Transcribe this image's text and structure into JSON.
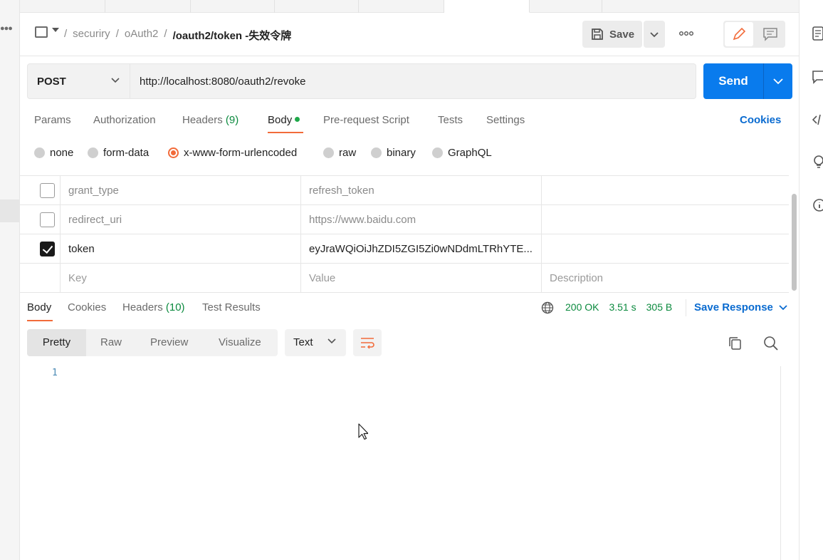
{
  "breadcrumb": {
    "items": [
      "securiry",
      "/",
      "oAuth2",
      "/"
    ],
    "current": "/oauth2/token -失效令牌"
  },
  "header": {
    "save_label": "Save",
    "more_label": "ooo"
  },
  "request": {
    "method": "POST",
    "url": "http://localhost:8080/oauth2/revoke",
    "send_label": "Send"
  },
  "request_tabs": {
    "params": "Params",
    "authorization": "Authorization",
    "headers": "Headers",
    "headers_count": "(9)",
    "body": "Body",
    "prerequest": "Pre-request Script",
    "tests": "Tests",
    "settings": "Settings",
    "cookies": "Cookies"
  },
  "body_types": {
    "none": "none",
    "form_data": "form-data",
    "urlencoded": "x-www-form-urlencoded",
    "raw": "raw",
    "binary": "binary",
    "graphql": "GraphQL",
    "selected": "x-www-form-urlencoded"
  },
  "params": {
    "rows": [
      {
        "checked": false,
        "key": "grant_type",
        "value": "refresh_token",
        "description": ""
      },
      {
        "checked": false,
        "key": "redirect_uri",
        "value": "https://www.baidu.com",
        "description": ""
      },
      {
        "checked": true,
        "key": "token",
        "value": "eyJraWQiOiJhZDI5ZGI5Zi0wNDdmLTRhYTE...",
        "description": ""
      }
    ],
    "placeholder_key": "Key",
    "placeholder_value": "Value",
    "placeholder_description": "Description"
  },
  "response_tabs": {
    "body": "Body",
    "cookies": "Cookies",
    "headers": "Headers",
    "headers_count": "(10)",
    "test_results": "Test Results"
  },
  "response_status": {
    "status": "200 OK",
    "time": "3.51 s",
    "size": "305 B",
    "save_response": "Save Response"
  },
  "response_view": {
    "pretty": "Pretty",
    "raw": "Raw",
    "preview": "Preview",
    "visualize": "Visualize",
    "language": "Text"
  },
  "response_body": {
    "line_number": "1"
  },
  "colors": {
    "accent": "#f26b3a",
    "primary": "#097bed",
    "link": "#0a6bd0",
    "status_ok": "#0b8a3e"
  }
}
